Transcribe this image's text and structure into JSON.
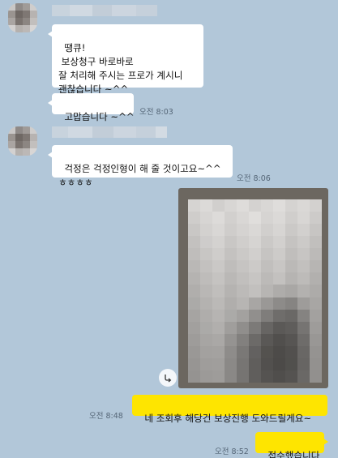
{
  "chat": {
    "messages": [
      {
        "sender": "other",
        "text": "땡큐!\n 보상청구 바로바로\n잘 처리해 주시는 프로가 계시니\n괜찮습니다 ~^^"
      },
      {
        "sender": "other",
        "text": "고맙습니다 ~^^",
        "time": "오전 8:03"
      },
      {
        "sender": "other",
        "text": "걱정은 걱정인형이 해 줄 것이고요~^^\nㅎㅎㅎㅎ",
        "time": "오전 8:06"
      },
      {
        "sender": "me",
        "text": "네 조회후 해당건 보상진행 도와드릴게요~",
        "time": "오전 8:48"
      },
      {
        "sender": "me",
        "text": "접수했습니다",
        "time": "오전 8:52"
      }
    ]
  },
  "icons": {
    "share": "share-arrow-icon",
    "avatar": "blurred-avatar-icon"
  },
  "colors": {
    "background": "#b2c7d9",
    "other_bubble": "#ffffff",
    "my_bubble": "#fee500",
    "time_text": "#556677"
  }
}
